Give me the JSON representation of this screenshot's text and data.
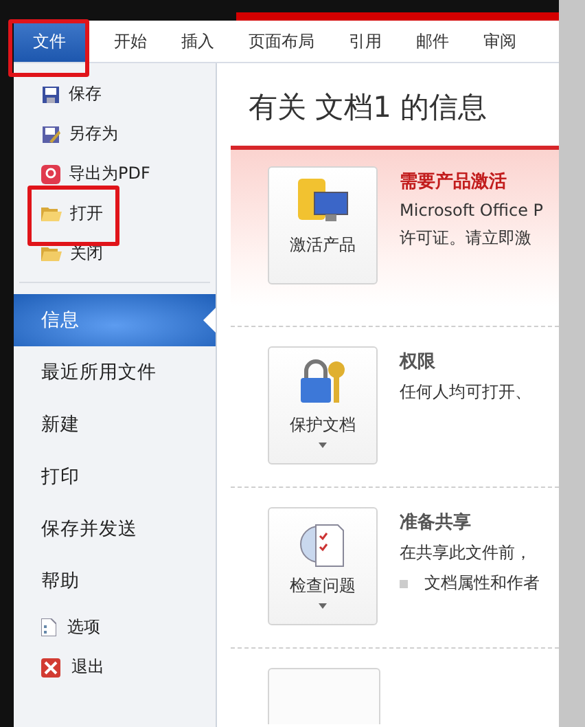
{
  "ribbon": {
    "tabs": [
      {
        "label": "文件",
        "selected": true
      },
      {
        "label": "开始",
        "selected": false
      },
      {
        "label": "插入",
        "selected": false
      },
      {
        "label": "页面布局",
        "selected": false
      },
      {
        "label": "引用",
        "selected": false
      },
      {
        "label": "邮件",
        "selected": false
      },
      {
        "label": "审阅",
        "selected": false
      }
    ]
  },
  "menu": {
    "items": [
      {
        "label": "保存",
        "kind": "command",
        "selected": false
      },
      {
        "label": "另存为",
        "kind": "command",
        "selected": false
      },
      {
        "label": "导出为PDF",
        "kind": "command",
        "selected": false
      },
      {
        "label": "打开",
        "kind": "command",
        "selected": false
      },
      {
        "label": "关闭",
        "kind": "command",
        "selected": false
      },
      {
        "label": "信息",
        "kind": "page",
        "selected": true
      },
      {
        "label": "最近所用文件",
        "kind": "page",
        "selected": false
      },
      {
        "label": "新建",
        "kind": "page",
        "selected": false
      },
      {
        "label": "打印",
        "kind": "page",
        "selected": false
      },
      {
        "label": "保存并发送",
        "kind": "page",
        "selected": false
      },
      {
        "label": "帮助",
        "kind": "page",
        "selected": false
      },
      {
        "label": "选项",
        "kind": "small",
        "selected": false
      },
      {
        "label": "退出",
        "kind": "small",
        "selected": false
      }
    ]
  },
  "info": {
    "title": "有关 文档1 的信息",
    "sections": [
      {
        "kind": "alert",
        "button": "激活产品",
        "dropdown": false,
        "heading": "需要产品激活",
        "lines": [
          "Microsoft Office P",
          "许可证。请立即激"
        ]
      },
      {
        "kind": "normal",
        "button": "保护文档",
        "dropdown": true,
        "heading": "权限",
        "lines": [
          "任何人均可打开、"
        ]
      },
      {
        "kind": "normal",
        "button": "检查问题",
        "dropdown": true,
        "heading": "准备共享",
        "lines": [
          "在共享此文件前，"
        ],
        "bullets": [
          "文档属性和作者"
        ]
      }
    ]
  }
}
